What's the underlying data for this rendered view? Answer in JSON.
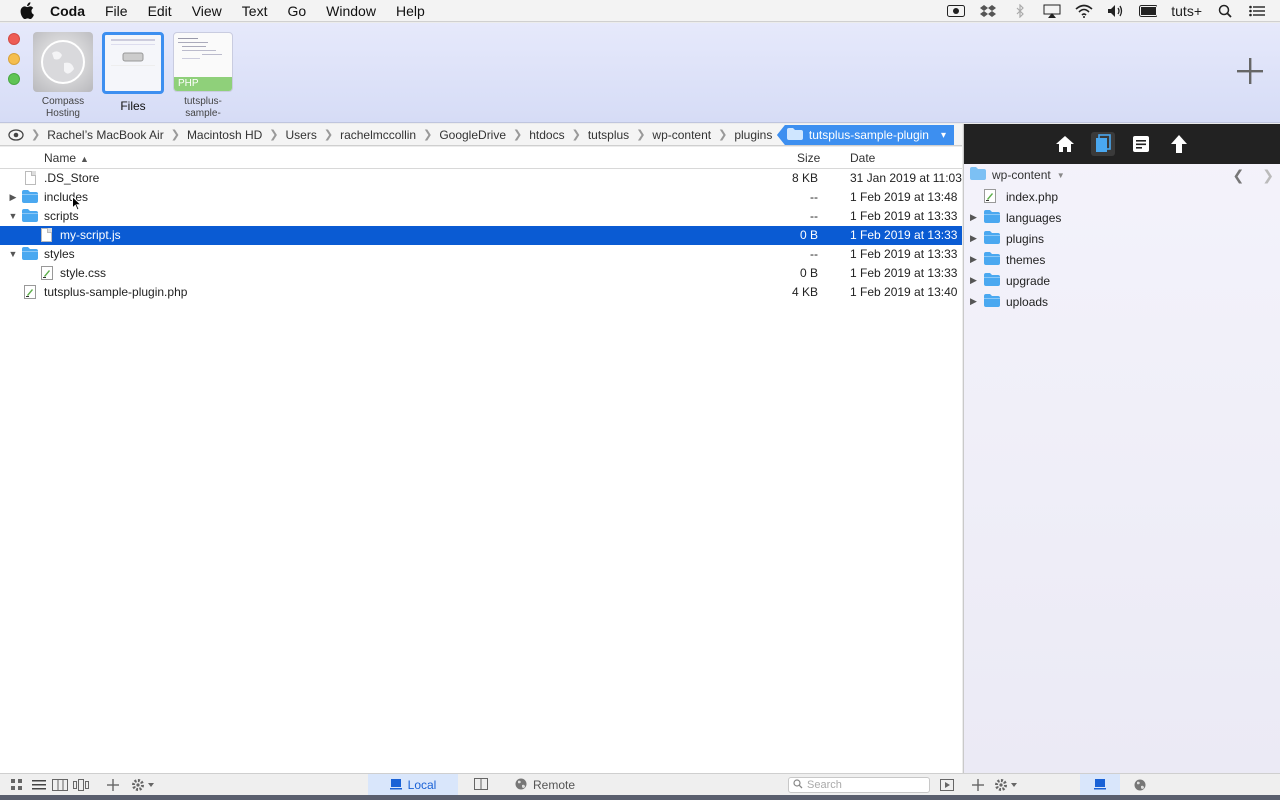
{
  "menubar": {
    "app": "Coda",
    "items": [
      "File",
      "Edit",
      "View",
      "Text",
      "Go",
      "Window",
      "Help"
    ],
    "user": "tuts+"
  },
  "tabs": [
    {
      "label_line1": "Compass",
      "label_line2": "Hosting"
    },
    {
      "label_line1": "Files",
      "label_line2": ""
    },
    {
      "label_line1": "tutsplus-",
      "label_line2": "sample-",
      "badge": "PHP"
    }
  ],
  "breadcrumb": {
    "items": [
      "Rachel’s MacBook Air",
      "Macintosh HD",
      "Users",
      "rachelmccollin",
      "GoogleDrive",
      "htdocs",
      "tutsplus",
      "wp-content",
      "plugins"
    ],
    "current": "tutsplus-sample-plugin"
  },
  "file_list": {
    "columns": {
      "name": "Name",
      "size": "Size",
      "date": "Date"
    },
    "rows": [
      {
        "name": ".DS_Store",
        "size": "8 KB",
        "date": "31 Jan 2019 at 11:03"
      },
      {
        "name": "includes",
        "size": "--",
        "date": "1 Feb 2019 at 13:48"
      },
      {
        "name": "scripts",
        "size": "--",
        "date": "1 Feb 2019 at 13:33"
      },
      {
        "name": "my-script.js",
        "size": "0 B",
        "date": "1 Feb 2019 at 13:33"
      },
      {
        "name": "styles",
        "size": "--",
        "date": "1 Feb 2019 at 13:33"
      },
      {
        "name": "style.css",
        "size": "0 B",
        "date": "1 Feb 2019 at 13:33"
      },
      {
        "name": "tutsplus-sample-plugin.php",
        "size": "4 KB",
        "date": "1 Feb 2019 at 13:40"
      }
    ]
  },
  "right_panel": {
    "path": "wp-content",
    "items": [
      "index.php",
      "languages",
      "plugins",
      "themes",
      "upgrade",
      "uploads"
    ]
  },
  "bottombar": {
    "local": "Local",
    "remote": "Remote",
    "search_placeholder": "Search"
  },
  "colors": {
    "selection": "#0a5bd3",
    "folder": "#4aa8f0",
    "accent": "#3d8ff0"
  }
}
